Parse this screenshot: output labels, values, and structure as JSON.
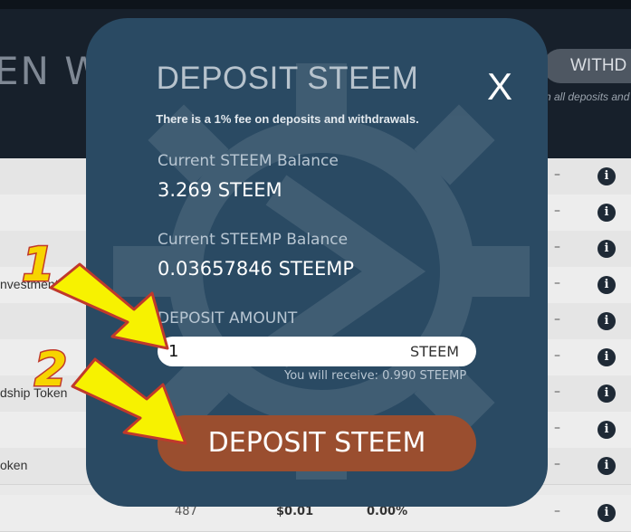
{
  "header": {
    "title": "EN W",
    "tab_label": "WITHD",
    "note": "n all deposits and"
  },
  "table": {
    "rows": [
      {
        "name": "",
        "dash": "–"
      },
      {
        "name": "",
        "dash": "–"
      },
      {
        "name": "",
        "dash": "–"
      },
      {
        "name": "nvestments",
        "dash": "–"
      },
      {
        "name": "",
        "dash": "–"
      },
      {
        "name": "",
        "dash": "–"
      },
      {
        "name": "dship Token",
        "dash": "–"
      },
      {
        "name": "",
        "dash": "–"
      },
      {
        "name": "oken",
        "dash": "–"
      }
    ],
    "last_row": {
      "c1": "487",
      "c2": "$0.01",
      "c3": "0.00%",
      "dash": "–"
    }
  },
  "modal": {
    "title": "DEPOSIT STEEM",
    "close_label": "X",
    "fee_note": "There is a 1% fee on deposits and withdrawals.",
    "steem_balance_label": "Current STEEM Balance",
    "steem_balance_value": "3.269 STEEM",
    "steemp_balance_label": "Current STEEMP Balance",
    "steemp_balance_value": "0.03657846 STEEMP",
    "amount_label": "DEPOSIT AMOUNT",
    "amount_value": "1",
    "amount_unit": "STEEM",
    "receive_note": "You will receive: 0.990 STEEMP",
    "deposit_button": "DEPOSIT STEEM"
  },
  "annotations": {
    "step1": "1",
    "step2": "2",
    "arrow_color": "#f7f200",
    "number_color": "#f7d400"
  },
  "colors": {
    "modal_bg": "#2a4a63",
    "deposit_button": "#9a4e2f",
    "header_bg": "#17202b"
  }
}
